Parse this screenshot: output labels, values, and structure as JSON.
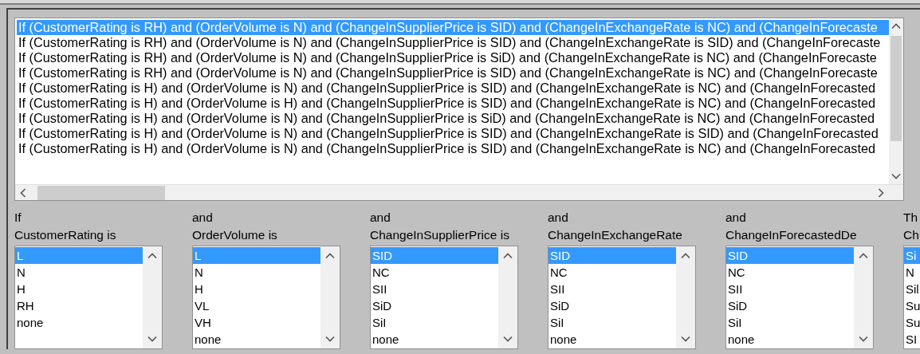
{
  "rules": [
    {
      "text": "If (CustomerRating is RH) and (OrderVolume is N) and (ChangeInSupplierPrice is SID) and (ChangeInExchangeRate is NC) and (ChangeInForecaste",
      "selected": true
    },
    {
      "text": "If (CustomerRating is RH) and (OrderVolume is N) and (ChangeInSupplierPrice is SID) and (ChangeInExchangeRate is SID) and (ChangeInForecaste",
      "selected": false
    },
    {
      "text": "If (CustomerRating is RH) and (OrderVolume is N) and (ChangeInSupplierPrice is SiD) and (ChangeInExchangeRate is NC) and (ChangeInForecaste",
      "selected": false
    },
    {
      "text": "If (CustomerRating is RH) and (OrderVolume is N) and (ChangeInSupplierPrice is SID) and (ChangeInExchangeRate is NC) and (ChangeInForecaste",
      "selected": false
    },
    {
      "text": "If (CustomerRating is H) and (OrderVolume is N) and (ChangeInSupplierPrice is SID) and (ChangeInExchangeRate is NC) and (ChangeInForecasted",
      "selected": false
    },
    {
      "text": "If (CustomerRating is H) and (OrderVolume is H) and (ChangeInSupplierPrice is SID) and (ChangeInExchangeRate is NC) and (ChangeInForecasted",
      "selected": false
    },
    {
      "text": "If (CustomerRating is H) and (OrderVolume is N) and (ChangeInSupplierPrice is SiD) and (ChangeInExchangeRate is NC) and (ChangeInForecasted",
      "selected": false
    },
    {
      "text": "If (CustomerRating is H) and (OrderVolume is N) and (ChangeInSupplierPrice is SID) and (ChangeInExchangeRate is SID) and (ChangeInForecasted",
      "selected": false
    },
    {
      "text": "If (CustomerRating is H) and (OrderVolume is N) and (ChangeInSupplierPrice is SID) and (ChangeInExchangeRate is NC) and (ChangeInForecasted",
      "selected": false
    }
  ],
  "columns": [
    {
      "conjunction": "If",
      "header": "CustomerRating is",
      "options": [
        {
          "label": "L",
          "selected": true
        },
        {
          "label": "N",
          "selected": false
        },
        {
          "label": "H",
          "selected": false
        },
        {
          "label": "RH",
          "selected": false
        },
        {
          "label": "none",
          "selected": false
        }
      ]
    },
    {
      "conjunction": "and",
      "header": "OrderVolume is",
      "options": [
        {
          "label": "L",
          "selected": true
        },
        {
          "label": "N",
          "selected": false
        },
        {
          "label": "H",
          "selected": false
        },
        {
          "label": "VL",
          "selected": false
        },
        {
          "label": "VH",
          "selected": false
        },
        {
          "label": "none",
          "selected": false
        }
      ]
    },
    {
      "conjunction": "and",
      "header": "ChangeInSupplierPrice is",
      "options": [
        {
          "label": "SID",
          "selected": true
        },
        {
          "label": "NC",
          "selected": false
        },
        {
          "label": "SII",
          "selected": false
        },
        {
          "label": "SiD",
          "selected": false
        },
        {
          "label": "SiI",
          "selected": false
        },
        {
          "label": "none",
          "selected": false
        }
      ]
    },
    {
      "conjunction": "and",
      "header": "ChangeInExchangeRate",
      "options": [
        {
          "label": "SID",
          "selected": true
        },
        {
          "label": "NC",
          "selected": false
        },
        {
          "label": "SII",
          "selected": false
        },
        {
          "label": "SiD",
          "selected": false
        },
        {
          "label": "SiI",
          "selected": false
        },
        {
          "label": "none",
          "selected": false
        }
      ]
    },
    {
      "conjunction": "and",
      "header": "ChangeInForecastedDe",
      "options": [
        {
          "label": "SID",
          "selected": true
        },
        {
          "label": "NC",
          "selected": false
        },
        {
          "label": "SII",
          "selected": false
        },
        {
          "label": "SiD",
          "selected": false
        },
        {
          "label": "SiI",
          "selected": false
        },
        {
          "label": "none",
          "selected": false
        }
      ]
    },
    {
      "conjunction": "Th",
      "header": "Ch",
      "options": [
        {
          "label": "Si",
          "selected": true
        },
        {
          "label": "N",
          "selected": false
        },
        {
          "label": "Sil",
          "selected": false
        },
        {
          "label": "Su",
          "selected": false
        },
        {
          "label": "Su",
          "selected": false
        },
        {
          "label": "SI",
          "selected": false
        }
      ]
    }
  ]
}
